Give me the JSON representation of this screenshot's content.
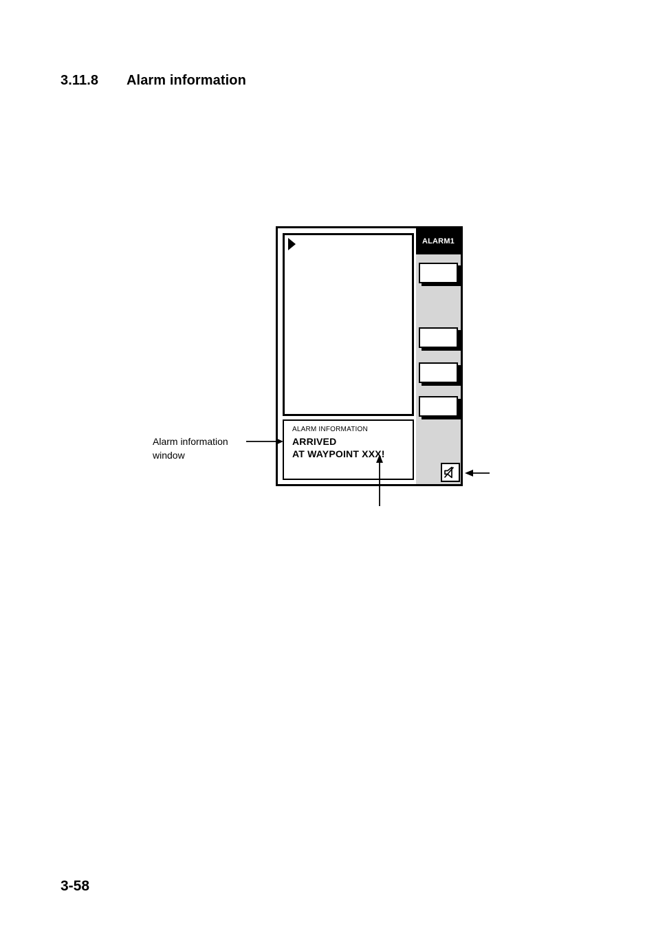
{
  "page": {
    "section_number": "3.11.8",
    "section_title": "Alarm information",
    "page_number": "3-58"
  },
  "figure": {
    "device": {
      "alarm_title": "ALARM1",
      "display_area": {
        "cursor_icon": "play-triangle-cursor"
      },
      "softkeys": [
        {
          "label": ""
        },
        {
          "label": ""
        },
        {
          "label": ""
        },
        {
          "label": ""
        }
      ],
      "mute_icon": "speaker-mute-icon"
    },
    "alarm_window": {
      "caption": "ALARM INFORMATION",
      "line1": "ARRIVED",
      "line2": "AT WAYPOINT XXX!"
    },
    "callouts": [
      {
        "text_line1": "Alarm information",
        "text_line2": "window"
      }
    ]
  },
  "colors": {
    "panel_gray": "#d6d6d6",
    "frame_black": "#000000",
    "screen_white": "#ffffff"
  }
}
